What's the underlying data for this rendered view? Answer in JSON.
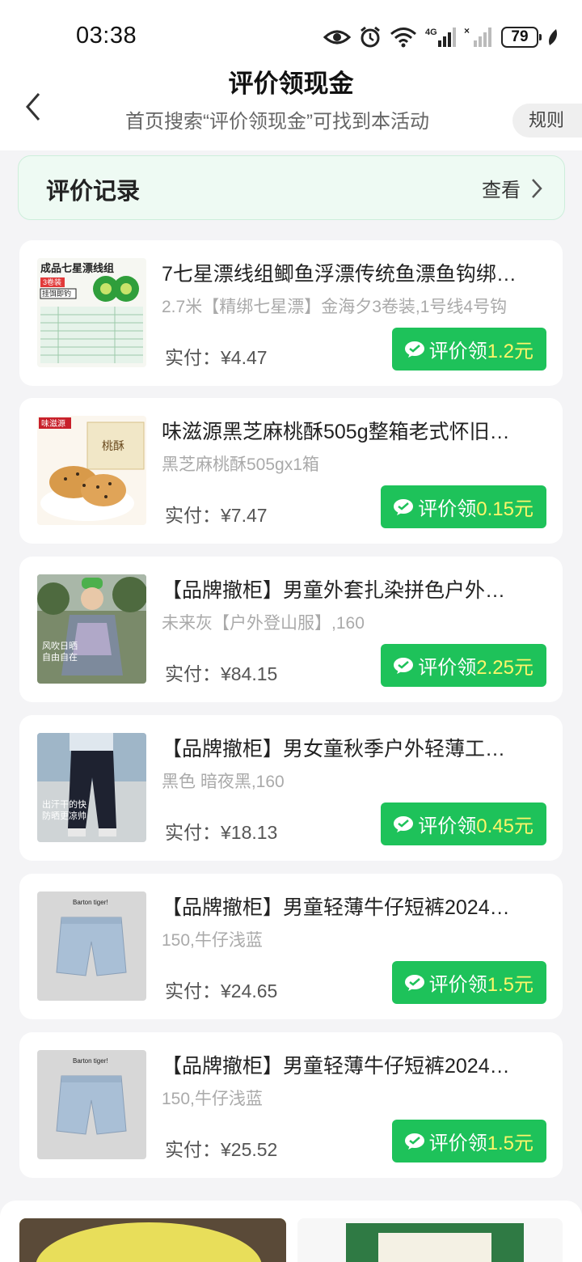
{
  "status_bar": {
    "time": "03:38",
    "network": "4G",
    "battery": "79"
  },
  "header": {
    "title": "评价领现金",
    "subtitle": "首页搜索“评价领现金”可找到本活动",
    "rules_label": "规则"
  },
  "record": {
    "title": "评价记录",
    "view_label": "查看"
  },
  "items": [
    {
      "title": "7七星漂线组鲫鱼浮漂传统鱼漂鱼钩绑…",
      "spec": "2.7米【精绑七星漂】金海夕3卷装,1号线4号钩",
      "paid": "实付：¥4.47",
      "reward_label": "评价领",
      "reward_amount": "1.2元",
      "thumb_text": "成品七星漂线组",
      "thumb_badge": "3卷装",
      "thumb_sub": "挂饵即钓"
    },
    {
      "title": "味滋源黑芝麻桃酥505g整箱老式怀旧…",
      "spec": "黑芝麻桃酥505gx1箱",
      "paid": "实付：¥7.47",
      "reward_label": "评价领",
      "reward_amount": "0.15元",
      "thumb_text": "味滋源",
      "thumb_sub": "桃酥"
    },
    {
      "title": "【品牌撤柜】男童外套扎染拼色户外…",
      "spec": "未来灰【户外登山服】,160",
      "paid": "实付：¥84.15",
      "reward_label": "评价领",
      "reward_amount": "2.25元",
      "thumb_text": "风吹日晒\n自由自在"
    },
    {
      "title": "【品牌撤柜】男女童秋季户外轻薄工…",
      "spec": "黑色 暗夜黑,160",
      "paid": "实付：¥18.13",
      "reward_label": "评价领",
      "reward_amount": "0.45元",
      "thumb_text": "出汗干的快\n防晒更凉帅"
    },
    {
      "title": "【品牌撤柜】男童轻薄牛仔短裤2024…",
      "spec": "150,牛仔浅蓝",
      "paid": "实付：¥24.65",
      "reward_label": "评价领",
      "reward_amount": "1.5元",
      "thumb_text": "Barton tiger!"
    },
    {
      "title": "【品牌撤柜】男童轻薄牛仔短裤2024…",
      "spec": "150,牛仔浅蓝",
      "paid": "实付：¥25.52",
      "reward_label": "评价领",
      "reward_amount": "1.5元",
      "thumb_text": "Barton tiger!"
    }
  ],
  "colors": {
    "accent_green": "#1ec25a",
    "amount_yellow": "#fff66a",
    "record_bg": "#eefaf3"
  }
}
